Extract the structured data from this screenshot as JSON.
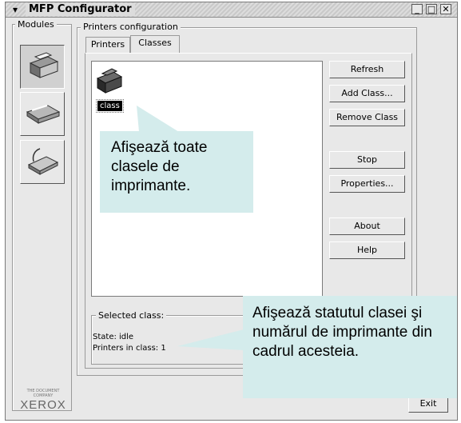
{
  "window": {
    "title": "MFP Configurator"
  },
  "modules": {
    "label": "Modules",
    "items": [
      {
        "name": "printers-module",
        "active": true
      },
      {
        "name": "scanners-module",
        "active": false
      },
      {
        "name": "ports-module",
        "active": false
      }
    ]
  },
  "printers_configuration": {
    "label": "Printers configuration",
    "tabs": [
      {
        "label": "Printers",
        "active": false
      },
      {
        "label": "Classes",
        "active": true
      }
    ]
  },
  "class_list": {
    "items": [
      {
        "label": "class",
        "selected": true
      }
    ]
  },
  "buttons": {
    "refresh": "Refresh",
    "add_class": "Add Class...",
    "remove_class": "Remove Class",
    "stop": "Stop",
    "properties": "Properties...",
    "about": "About",
    "help": "Help",
    "exit": "Exit"
  },
  "selected_class": {
    "label": "Selected class:",
    "state": "State: idle",
    "printers": "Printers in class: 1"
  },
  "callouts": {
    "top": "Afişează toate clasele de imprimante.",
    "bottom": "Afişează statutul clasei şi numărul de imprimante din cadrul acesteia."
  },
  "branding": {
    "logo": "XEROX",
    "tagline": "THE DOCUMENT COMPANY"
  },
  "colors": {
    "callout_bg": "#d4ecec",
    "selection_bg": "#000000",
    "window_bg": "#e8e8e8"
  }
}
